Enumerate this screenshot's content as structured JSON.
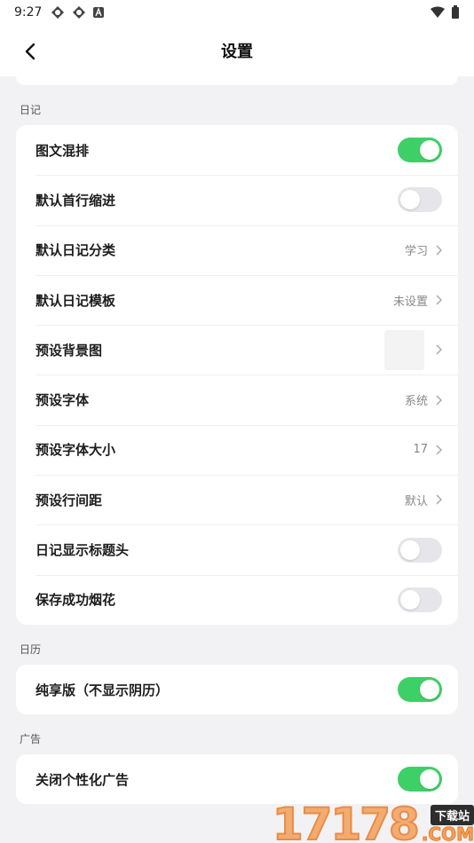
{
  "status": {
    "time": "9:27"
  },
  "header": {
    "title": "设置"
  },
  "sections": {
    "diary": {
      "label": "日记",
      "rows": [
        {
          "label": "图文混排",
          "toggle": true
        },
        {
          "label": "默认首行缩进",
          "toggle": false
        },
        {
          "label": "默认日记分类",
          "value": "学习"
        },
        {
          "label": "默认日记模板",
          "value": "未设置"
        },
        {
          "label": "预设背景图"
        },
        {
          "label": "预设字体",
          "value": "系统"
        },
        {
          "label": "预设字体大小",
          "value": "17"
        },
        {
          "label": "预设行间距",
          "value": "默认"
        },
        {
          "label": "日记显示标题头",
          "toggle": false
        },
        {
          "label": "保存成功烟花",
          "toggle": false
        }
      ]
    },
    "calendar": {
      "label": "日历",
      "rows": [
        {
          "label": "纯享版（不显示阴历）",
          "toggle": true
        }
      ]
    },
    "ads": {
      "label": "广告",
      "rows": [
        {
          "label": "关闭个性化广告",
          "toggle": true
        }
      ]
    }
  },
  "watermark": {
    "number": "17178",
    "tag": "下载站",
    "suffix": ".COM"
  },
  "colors": {
    "toggle_on": "#3dd067",
    "toggle_off": "#e6e6ea",
    "background": "#f2f2f4"
  }
}
